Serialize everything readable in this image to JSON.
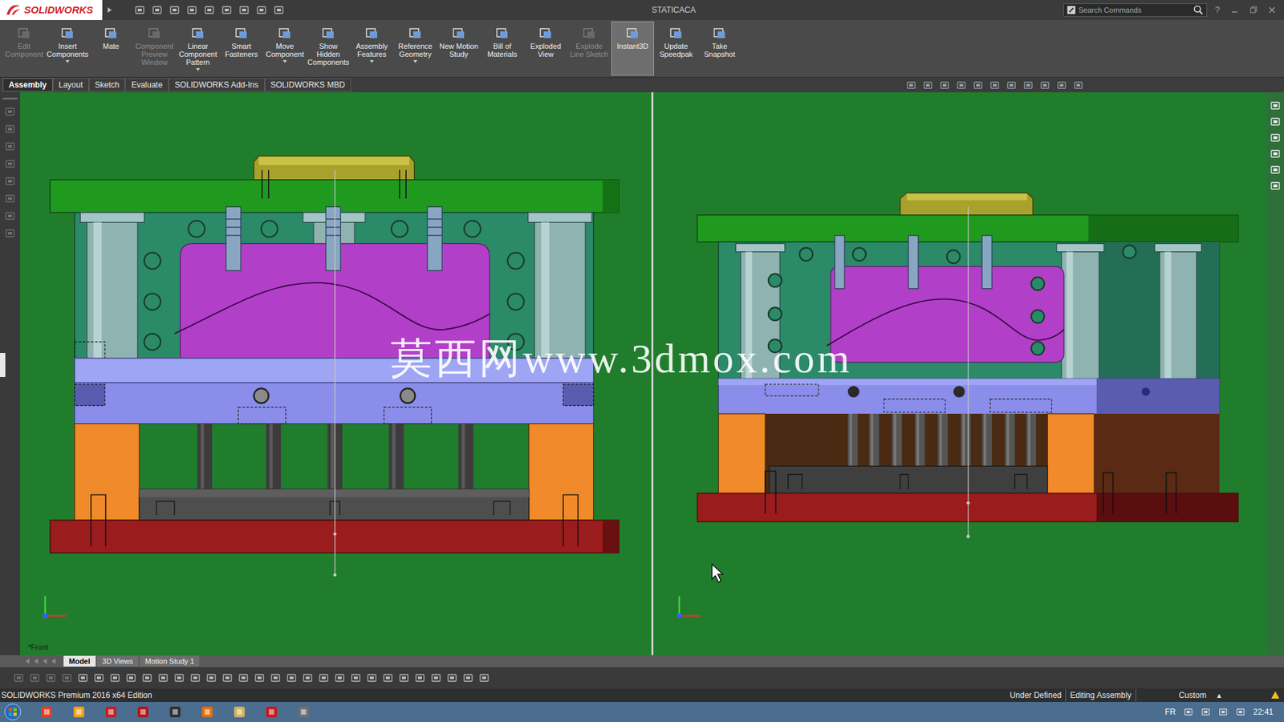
{
  "window": {
    "logo": "SOLIDWORKS",
    "title": "STATICACA",
    "help": "?"
  },
  "search": {
    "placeholder": "Search Commands"
  },
  "ribbon": [
    {
      "label": "Edit Component",
      "disabled": true,
      "selected": false,
      "dropdown": false
    },
    {
      "label": "Insert Components",
      "disabled": false,
      "selected": false,
      "dropdown": true
    },
    {
      "label": "Mate",
      "disabled": false,
      "selected": false,
      "dropdown": false
    },
    {
      "label": "Component Preview Window",
      "disabled": true,
      "selected": false,
      "dropdown": false
    },
    {
      "label": "Linear Component Pattern",
      "disabled": false,
      "selected": false,
      "dropdown": true
    },
    {
      "label": "Smart Fasteners",
      "disabled": false,
      "selected": false,
      "dropdown": false
    },
    {
      "label": "Move Component",
      "disabled": false,
      "selected": false,
      "dropdown": true
    },
    {
      "label": "Show Hidden Components",
      "disabled": false,
      "selected": false,
      "dropdown": false
    },
    {
      "label": "Assembly Features",
      "disabled": false,
      "selected": false,
      "dropdown": true
    },
    {
      "label": "Reference Geometry",
      "disabled": false,
      "selected": false,
      "dropdown": true
    },
    {
      "label": "New Motion Study",
      "disabled": false,
      "selected": false,
      "dropdown": false
    },
    {
      "label": "Bill of Materials",
      "disabled": false,
      "selected": false,
      "dropdown": false
    },
    {
      "label": "Exploded View",
      "disabled": false,
      "selected": false,
      "dropdown": false
    },
    {
      "label": "Explode Line Sketch",
      "disabled": true,
      "selected": false,
      "dropdown": false
    },
    {
      "label": "Instant3D",
      "disabled": false,
      "selected": true,
      "dropdown": false
    },
    {
      "label": "Update Speedpak",
      "disabled": false,
      "selected": false,
      "dropdown": false
    },
    {
      "label": "Take Snapshot",
      "disabled": false,
      "selected": false,
      "dropdown": false
    }
  ],
  "tabs": [
    {
      "label": "Assembly",
      "selected": true
    },
    {
      "label": "Layout",
      "selected": false
    },
    {
      "label": "Sketch",
      "selected": false
    },
    {
      "label": "Evaluate",
      "selected": false
    },
    {
      "label": "SOLIDWORKS Add-Ins",
      "selected": false
    },
    {
      "label": "SOLIDWORKS MBD",
      "selected": false
    }
  ],
  "view_label": "*Front",
  "watermark": "莫西网www.3dmox.com",
  "bottom_tabs": [
    {
      "label": "Model",
      "selected": true
    },
    {
      "label": "3D Views",
      "selected": false
    },
    {
      "label": "Motion Study 1",
      "selected": false
    }
  ],
  "status_bar": {
    "edition": "SOLIDWORKS Premium 2016 x64 Edition",
    "items": [
      "Under Defined",
      "Editing Assembly"
    ],
    "units": "Custom",
    "units_arrow": "▴"
  },
  "taskbar": {
    "language": "FR",
    "time": "22:41"
  }
}
